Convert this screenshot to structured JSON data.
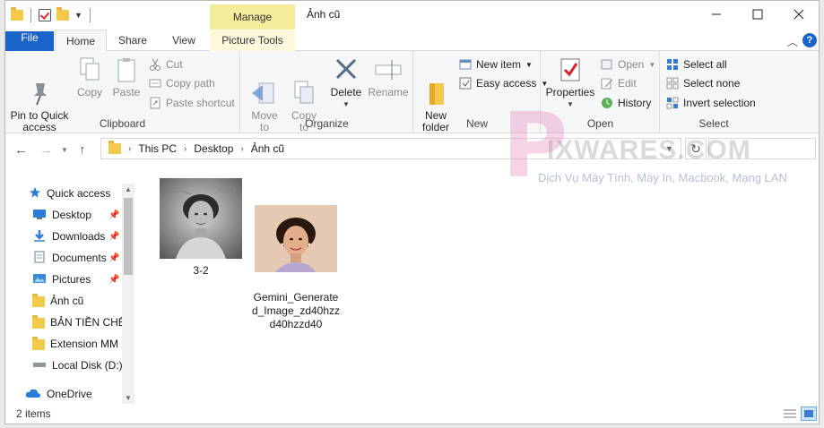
{
  "window": {
    "title": "Ảnh cũ",
    "context_tab": "Manage"
  },
  "tabs": [
    {
      "label": "File"
    },
    {
      "label": "Home"
    },
    {
      "label": "Share"
    },
    {
      "label": "View"
    },
    {
      "label": "Picture Tools"
    }
  ],
  "ribbon": {
    "clipboard": {
      "label": "Clipboard",
      "pin": "Pin to Quick\naccess",
      "copy": "Copy",
      "paste": "Paste",
      "cut": "Cut",
      "copy_path": "Copy path",
      "paste_shortcut": "Paste shortcut"
    },
    "organize": {
      "label": "Organize",
      "move_to": "Move\nto",
      "copy_to": "Copy\nto",
      "delete": "Delete",
      "rename": "Rename"
    },
    "new": {
      "label": "New",
      "new_folder": "New\nfolder",
      "new_item": "New item",
      "easy_access": "Easy access"
    },
    "open": {
      "label": "Open",
      "properties": "Properties",
      "open": "Open",
      "edit": "Edit",
      "history": "History"
    },
    "select": {
      "label": "Select",
      "select_all": "Select all",
      "select_none": "Select none",
      "invert": "Invert selection"
    }
  },
  "address": {
    "crumbs": [
      "This PC",
      "Desktop",
      "Ảnh cũ"
    ]
  },
  "nav": {
    "items": [
      {
        "label": "Quick access",
        "icon": "star-icon",
        "pinned": false
      },
      {
        "label": "Desktop",
        "icon": "desktop-icon",
        "pinned": true
      },
      {
        "label": "Downloads",
        "icon": "download-icon",
        "pinned": true
      },
      {
        "label": "Documents",
        "icon": "document-icon",
        "pinned": true
      },
      {
        "label": "Pictures",
        "icon": "pictures-icon",
        "pinned": true
      },
      {
        "label": "Ảnh cũ",
        "icon": "folder-icon",
        "pinned": false
      },
      {
        "label": "BẢN TIỀN CHẾ",
        "icon": "folder-icon",
        "pinned": false
      },
      {
        "label": "Extension MM",
        "icon": "folder-icon",
        "pinned": false
      },
      {
        "label": "Local Disk (D:)",
        "icon": "drive-icon",
        "pinned": false
      },
      {
        "label": "OneDrive",
        "icon": "cloud-icon",
        "pinned": false
      }
    ]
  },
  "files": [
    {
      "name": "3-2",
      "thumb": "grayscale-portrait"
    },
    {
      "name": "Gemini_Generate\nd_Image_zd40hzz\nd40hzzd40",
      "thumb": "color-portrait"
    }
  ],
  "status": {
    "count": "2 items"
  },
  "watermark": {
    "brand": "IXWARES.COM",
    "tagline": "Dịch Vụ Máy Tính, Máy In, Macbook, Mạng LAN"
  },
  "colors": {
    "accent": "#1a63c8",
    "manage": "#f5ec9b",
    "folder": "#f3c94c"
  }
}
